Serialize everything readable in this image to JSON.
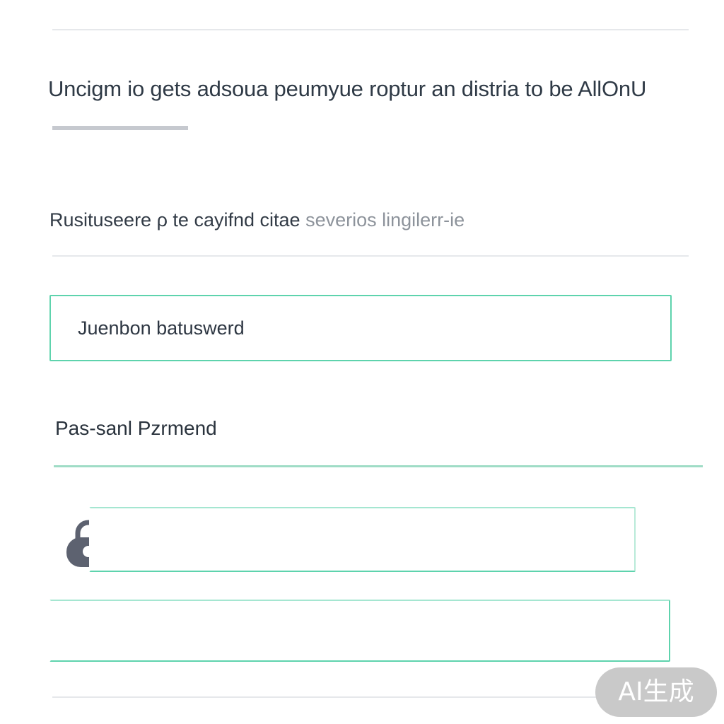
{
  "header": {
    "title": "Uncigm io gets adsoua peumyue roptur an distria to be AllOnU"
  },
  "description": {
    "text_main": "Rusituseere ρ te cayifnd citae",
    "text_faded": "severios lingilerr-ie"
  },
  "form": {
    "username_field": {
      "value": "Juenbon batuswerd",
      "placeholder": ""
    },
    "password_label": "Pas-sanl Pzrmend",
    "password_field": {
      "value": "",
      "icon": "lock-icon"
    },
    "confirm_field": {
      "value": ""
    }
  },
  "watermark": {
    "text": "AI生成"
  },
  "colors": {
    "accent": "#5ed3ad",
    "icon": "#5d6270",
    "divider": "#e6e8eb",
    "badge": "#c9c9c9"
  }
}
